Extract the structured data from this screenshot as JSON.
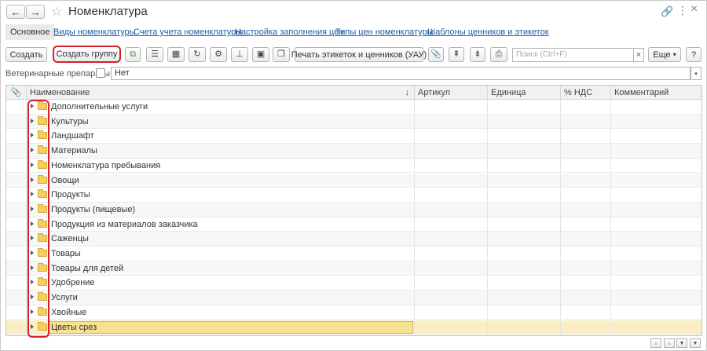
{
  "window": {
    "title": "Номенклатура",
    "back_icon": "←",
    "forward_icon": "→",
    "star_icon": "☆",
    "link_icon": "🔗",
    "more_icon": "⋮",
    "close_icon": "×"
  },
  "tabs": [
    {
      "label": "Основное",
      "active": true
    },
    {
      "label": "Виды номенклатуры",
      "active": false
    },
    {
      "label": "Счета учета номенклатуры",
      "active": false
    },
    {
      "label": "Настройка заполнения цен",
      "active": false
    },
    {
      "label": "Типы цен номенклатуры",
      "active": false
    },
    {
      "label": "Шаблоны ценников и этикеток",
      "active": false
    }
  ],
  "toolbar": {
    "create_label": "Создать",
    "create_group_label": "Создать группу",
    "print_label": "Печать этикеток и ценников (УАУ)",
    "search_placeholder": "Поиск (Ctrl+F)",
    "search_clear": "×",
    "more_label": "Еще",
    "more_arrow": "▾",
    "help_label": "?",
    "icons": {
      "copy": "⧉",
      "lines": "☰",
      "calc": "▦",
      "refresh": "↻",
      "settings": "⚙",
      "hierarchy": "⊥",
      "cube": "▣",
      "windows": "❐",
      "attach": "📎",
      "up": "⇞",
      "down": "⇟",
      "printer": "⎙"
    }
  },
  "filter": {
    "label": "Ветеринарные препараты:",
    "value": "Нет",
    "arrow": "▾"
  },
  "grid": {
    "attach_icon": "📎",
    "sort_icon": "↓",
    "columns": [
      "Наименование",
      "Артикул",
      "Единица",
      "% НДС",
      "Комментарий"
    ],
    "rows": [
      "Дополнительные услуги",
      "Культуры",
      "Ландшафт",
      "Материалы",
      "Номенклатура пребывания",
      "Овощи",
      "Продукты",
      "Продукты (пищевые)",
      "Продукция из материалов заказчика",
      "Саженцы",
      "Товары",
      "Товары для детей",
      "Удобрение",
      "Услуги",
      "Хвойные",
      "Цветы срез"
    ],
    "selected_index": 15
  },
  "scroll": {
    "first": "▲",
    "up": "▲",
    "down": "▼",
    "last": "▼"
  }
}
